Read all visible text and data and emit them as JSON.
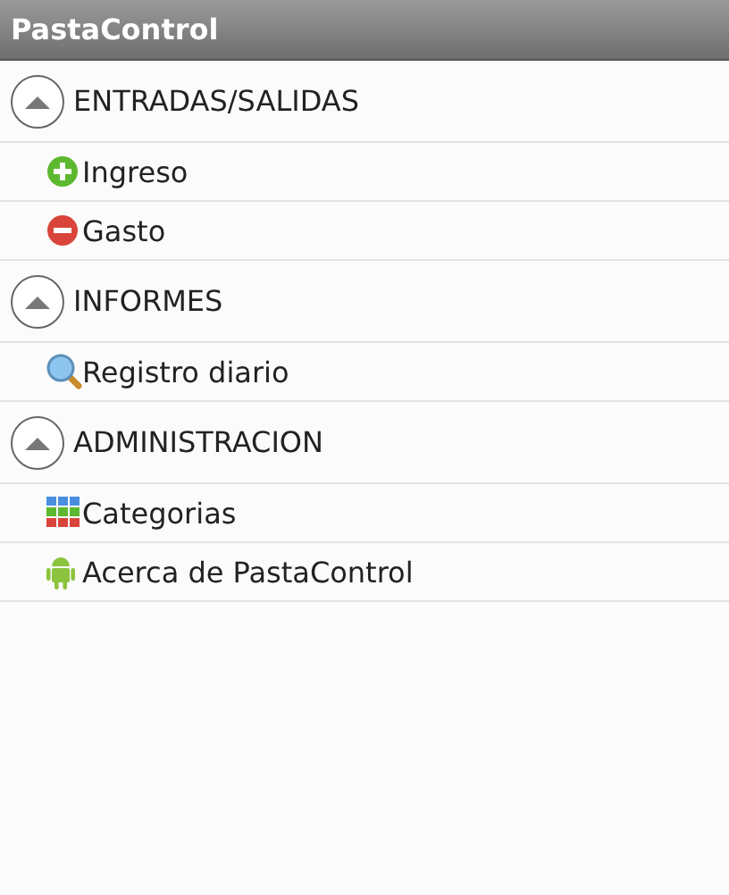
{
  "window": {
    "title": "PastaControl"
  },
  "groups": [
    {
      "label": "ENTRADAS/SALIDAS",
      "expanded": true,
      "items": [
        {
          "label": "Ingreso",
          "kind": "plus"
        },
        {
          "label": "Gasto",
          "kind": "minus"
        }
      ]
    },
    {
      "label": "INFORMES",
      "expanded": true,
      "items": [
        {
          "label": "Registro diario",
          "kind": "search"
        }
      ]
    },
    {
      "label": "ADMINISTRACION",
      "expanded": true,
      "items": [
        {
          "label": "Categorias",
          "kind": "grid"
        },
        {
          "label": "Acerca de PastaControl",
          "kind": "robot"
        }
      ]
    }
  ]
}
